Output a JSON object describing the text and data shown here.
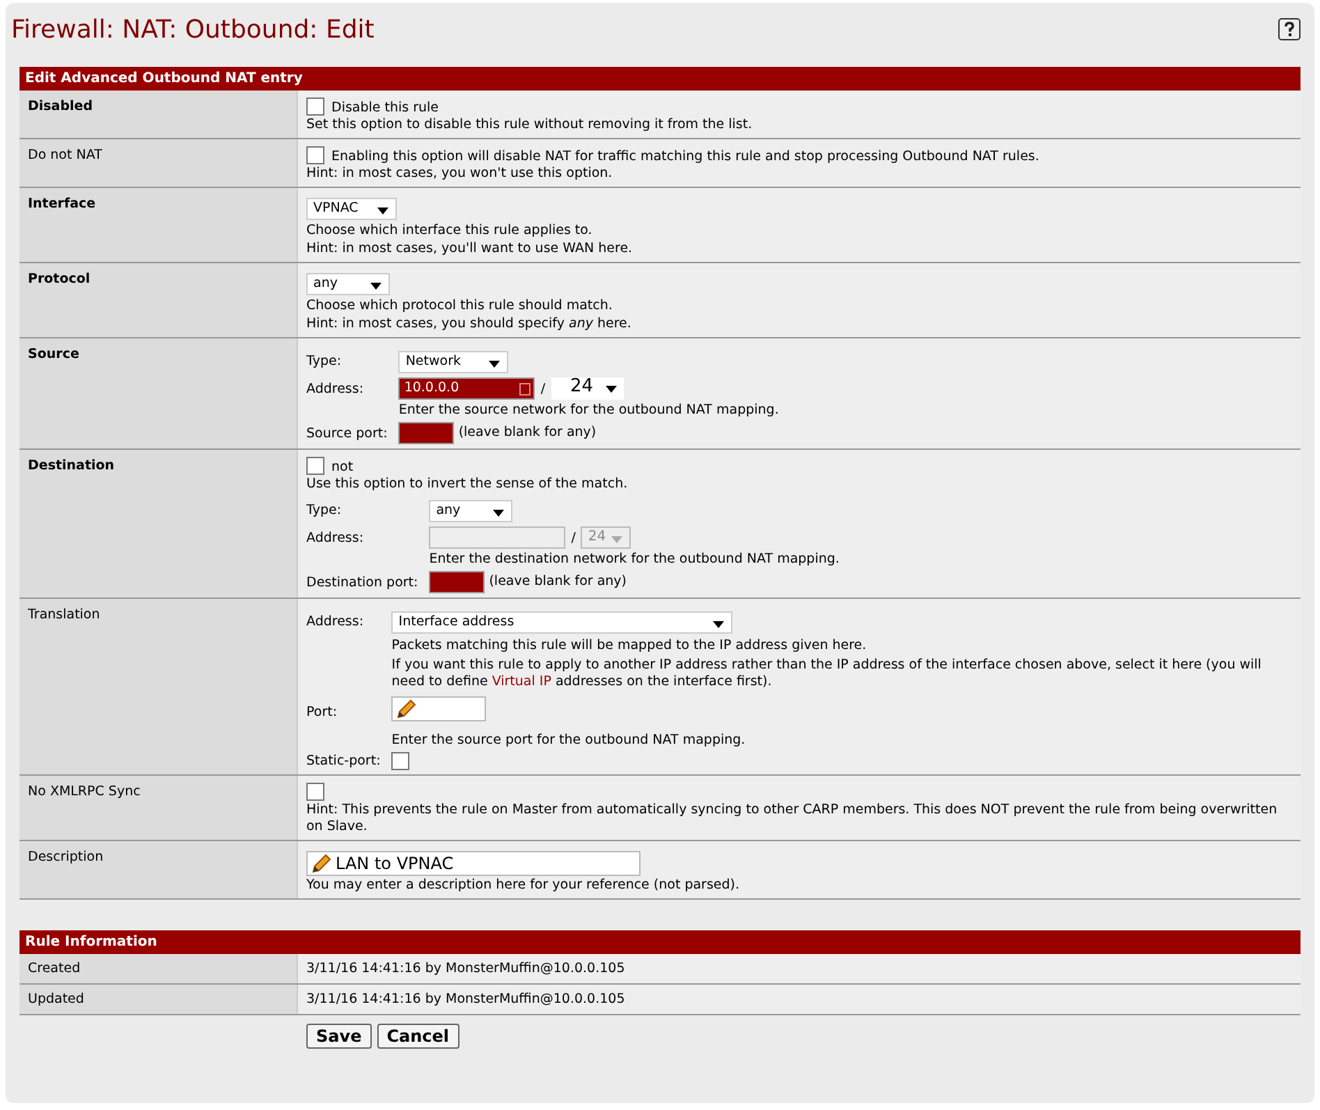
{
  "page_title": "Firewall: NAT: Outbound: Edit",
  "edit_section": {
    "title": "Edit Advanced Outbound NAT entry",
    "rows": [
      {
        "label": "Disabled",
        "bold": true,
        "items": [
          {
            "kind": "checkbox",
            "checked": false,
            "label": "Disable this rule"
          },
          {
            "kind": "hint",
            "text": "Set this option to disable this rule without removing it from the list."
          }
        ]
      },
      {
        "label": "Do not NAT",
        "bold": false,
        "items": [
          {
            "kind": "checkbox",
            "checked": false,
            "label": "Enabling this option will disable NAT for traffic matching this rule and stop processing Outbound NAT rules."
          },
          {
            "kind": "hint",
            "text": "Hint: in most cases, you won't use this option."
          }
        ]
      },
      {
        "label": "Interface",
        "bold": true,
        "items": [
          {
            "kind": "select",
            "value": "VPNAC"
          },
          {
            "kind": "hint",
            "text": "Choose which interface this rule applies to."
          },
          {
            "kind": "hint",
            "text": "Hint: in most cases, you'll want to use WAN here."
          }
        ]
      },
      {
        "label": "Protocol",
        "bold": true,
        "items": [
          {
            "kind": "select",
            "value": "any"
          },
          {
            "kind": "hint",
            "text": "Choose which protocol this rule should match."
          },
          {
            "kind": "hint",
            "text": "Hint: in most cases, you should specify *any* here."
          }
        ]
      },
      {
        "label": "Source",
        "bold": true,
        "items": [
          {
            "kind": "form",
            "rows": [
              {
                "label": "Type:",
                "controls": [
                  {
                    "kind": "select",
                    "value": "Network"
                  }
                ]
              },
              {
                "label": "Address:",
                "controls": [
                  {
                    "kind": "field",
                    "value": "10.0.0.0",
                    "highlighted": true,
                    "disabled": false
                  },
                  {
                    "kind": "text",
                    "text": "/"
                  },
                  {
                    "kind": "mask",
                    "value": "24",
                    "disabled": false
                  }
                ]
              },
              {
                "controls": [
                  {
                    "kind": "note",
                    "text": "Enter the source network for the outbound NAT mapping."
                  }
                ]
              },
              {
                "label": "Source port:",
                "controls": [
                  {
                    "kind": "port",
                    "highlighted": true
                  },
                  {
                    "kind": "note",
                    "text": "(leave blank for any)"
                  }
                ]
              }
            ]
          }
        ]
      },
      {
        "label": "Destination",
        "bold": true,
        "items": [
          {
            "kind": "checkbox",
            "checked": false,
            "label": "not"
          },
          {
            "kind": "hint",
            "text": "Use this option to invert the sense of the match."
          },
          {
            "kind": "form",
            "rows": [
              {
                "label": "Type:",
                "controls": [
                  {
                    "kind": "select",
                    "value": "any"
                  }
                ]
              },
              {
                "label": "Address:",
                "controls": [
                  {
                    "kind": "field",
                    "highlighted": false,
                    "disabled": true
                  },
                  {
                    "kind": "text",
                    "text": "/"
                  },
                  {
                    "kind": "mask",
                    "value": "24",
                    "disabled": true
                  }
                ]
              },
              {
                "controls": [
                  {
                    "kind": "note",
                    "text": "Enter the destination network for the outbound NAT mapping."
                  }
                ]
              },
              {
                "label": "Destination port:",
                "controls": [
                  {
                    "kind": "port",
                    "highlighted": true
                  },
                  {
                    "kind": "note",
                    "text": "(leave blank for any)"
                  }
                ]
              }
            ]
          }
        ]
      },
      {
        "label": "Translation",
        "bold": false,
        "items": [
          {
            "kind": "form",
            "rows": [
              {
                "label": "Address:",
                "controls": [
                  {
                    "kind": "select",
                    "value": "Interface address"
                  }
                ]
              },
              {
                "controls": [
                  {
                    "kind": "note",
                    "text": "Packets matching this rule will be mapped to the IP address given here."
                  }
                ]
              },
              {
                "controls": [
                  {
                    "kind": "linknote",
                    "before": "If you want this rule to apply to another IP address rather than the IP address of the interface chosen above, select it here (you will need to define",
                    "link": "Virtual IP",
                    "after": "addresses on the interface first)."
                  }
                ]
              },
              {
                "label": "Port:",
                "controls": [
                  {
                    "kind": "pencilfield"
                  }
                ]
              },
              {
                "controls": [
                  {
                    "kind": "note",
                    "text": "Enter the source port for the outbound NAT mapping."
                  }
                ]
              },
              {
                "label": "Static-port:",
                "controls": [
                  {
                    "kind": "checkbox",
                    "checked": false
                  }
                ]
              }
            ]
          }
        ]
      },
      {
        "label": "No XMLRPC Sync",
        "bold": false,
        "items": [
          {
            "kind": "checkbox",
            "checked": false
          },
          {
            "kind": "hint",
            "text": "Hint: This prevents the rule on Master from automatically syncing to other CARP members. This does NOT prevent the rule from being overwritten on Slave."
          }
        ]
      },
      {
        "label": "Description",
        "bold": false,
        "items": [
          {
            "kind": "pencilfield",
            "value": "LAN to VPNAC"
          },
          {
            "kind": "hint",
            "text": "You may enter a description here for your reference (not parsed)."
          }
        ]
      }
    ]
  },
  "info_section": {
    "title": "Rule Information",
    "rows": [
      {
        "label": "Created",
        "value": "3/11/16 14:41:16 by MonsterMuffin@10.0.0.105"
      },
      {
        "label": "Updated",
        "value": "3/11/16 14:41:16 by MonsterMuffin@10.0.0.105"
      }
    ]
  },
  "buttons": [
    "Save",
    "Cancel"
  ]
}
